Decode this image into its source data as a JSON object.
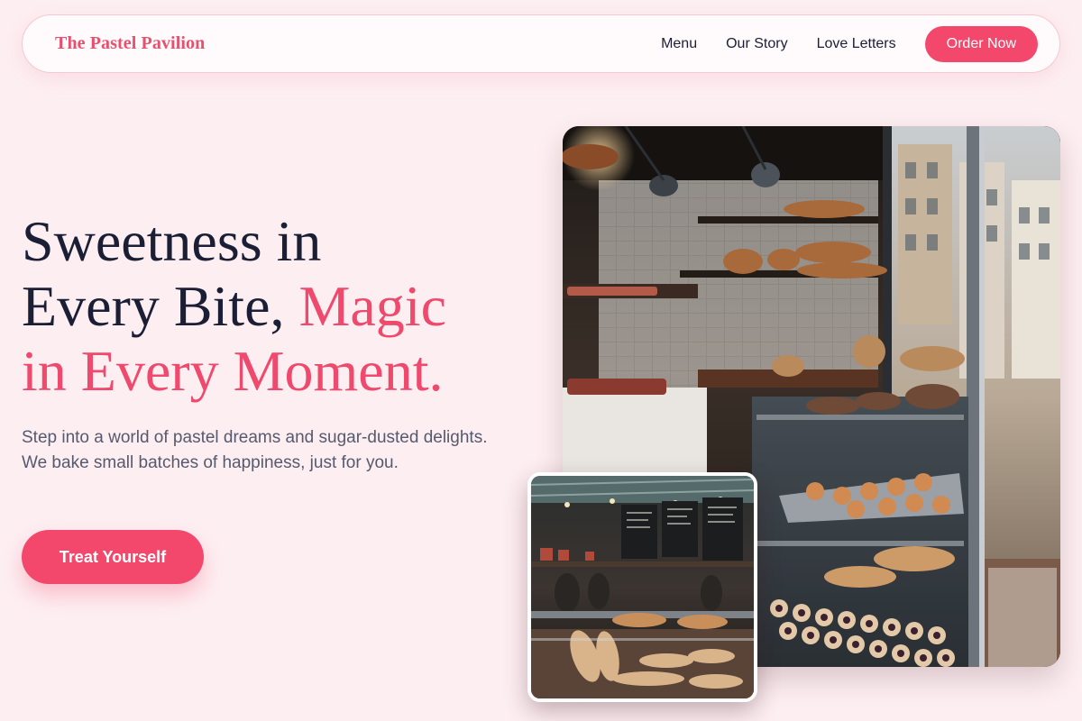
{
  "nav": {
    "brand": "The Pastel Pavilion",
    "links": [
      "Menu",
      "Our Story",
      "Love Letters"
    ],
    "cta": "Order Now"
  },
  "hero": {
    "title_line1": "Sweetness in",
    "title_line2_plain": "Every Bite, ",
    "title_line2_accent": "Magic",
    "title_line3_accent": "in Every Moment.",
    "subtitle": "Step into a world of pastel dreams and sugar-dusted delights. We bake small batches of happiness, just for you.",
    "cta": "Treat Yourself"
  },
  "images": {
    "main_alt": "Bakery display case with breads and pastries",
    "small_alt": "Busy bakery market counter"
  },
  "colors": {
    "accent": "#ef4a6d",
    "button": "#f3486b",
    "background": "#fdeef1",
    "heading": "#1b1f35"
  }
}
